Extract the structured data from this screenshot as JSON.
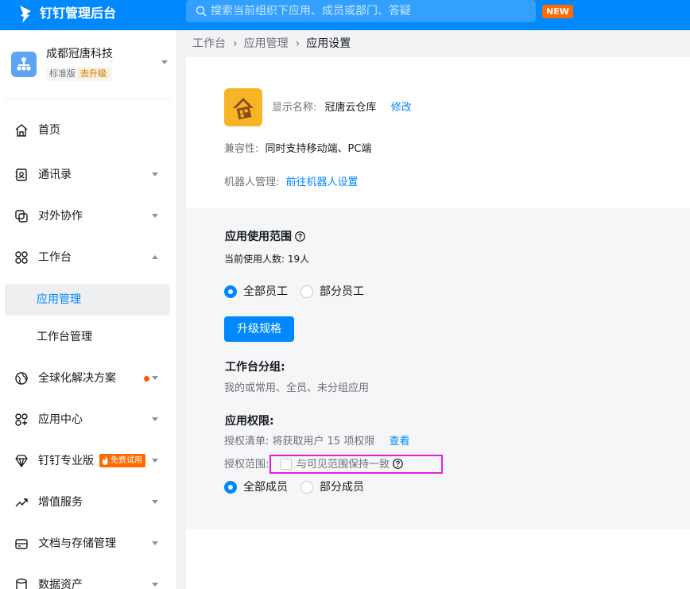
{
  "topbar": {
    "brand": "钉钉管理后台",
    "search_placeholder": "搜索当前组织下应用、成员或部门、答疑",
    "new_badge": "NEW",
    "accent": "#0089ff"
  },
  "org": {
    "name": "成都冠唐科技",
    "edition": "标准版",
    "upgrade": "去升级"
  },
  "nav": [
    {
      "label": "首页",
      "icon": "home-icon"
    },
    {
      "label": "通讯录",
      "icon": "contacts-icon"
    },
    {
      "label": "对外协作",
      "icon": "collaboration-icon"
    },
    {
      "label": "工作台",
      "icon": "workbench-icon"
    },
    {
      "label": "应用管理",
      "active": true
    },
    {
      "label": "工作台管理"
    },
    {
      "label": "全球化解决方案",
      "icon": "globe-icon",
      "dot": "#ff5219"
    },
    {
      "label": "应用中心",
      "icon": "app-center-icon"
    },
    {
      "label": "钉钉专业版",
      "icon": "diamond-icon",
      "badge": "免费试用"
    },
    {
      "label": "增值服务",
      "icon": "trend-icon"
    },
    {
      "label": "文档与存储管理",
      "icon": "storage-icon"
    },
    {
      "label": "数据资产",
      "icon": "data-icon"
    }
  ],
  "breadcrumb": [
    "工作台",
    "应用管理",
    "应用设置"
  ],
  "app": {
    "display_name_label": "显示名称:",
    "display_name": "冠唐云仓库",
    "edit": "修改",
    "compat_label": "兼容性:",
    "compat_value": "同时支持移动端、PC端",
    "robot_label": "机器人管理:",
    "robot_link": "前往机器人设置"
  },
  "scope": {
    "title": "应用使用范围",
    "current_users": "当前使用人数: 19人",
    "options": [
      "全部员工",
      "部分员工"
    ],
    "selected": 0,
    "upgrade_button": "升级规格"
  },
  "workbench_group": {
    "title": "工作台分组:",
    "value": "我的或常用、全员、未分组应用"
  },
  "permissions": {
    "title": "应用权限:",
    "list_label": "授权清单: 将获取用户 15 项权限",
    "view_link": "查看",
    "range_label": "授权范围:",
    "keep_consistent": "与可见范围保持一致",
    "keep_consistent_checked": false,
    "options": [
      "全部成员",
      "部分成员"
    ],
    "selected": 0
  }
}
